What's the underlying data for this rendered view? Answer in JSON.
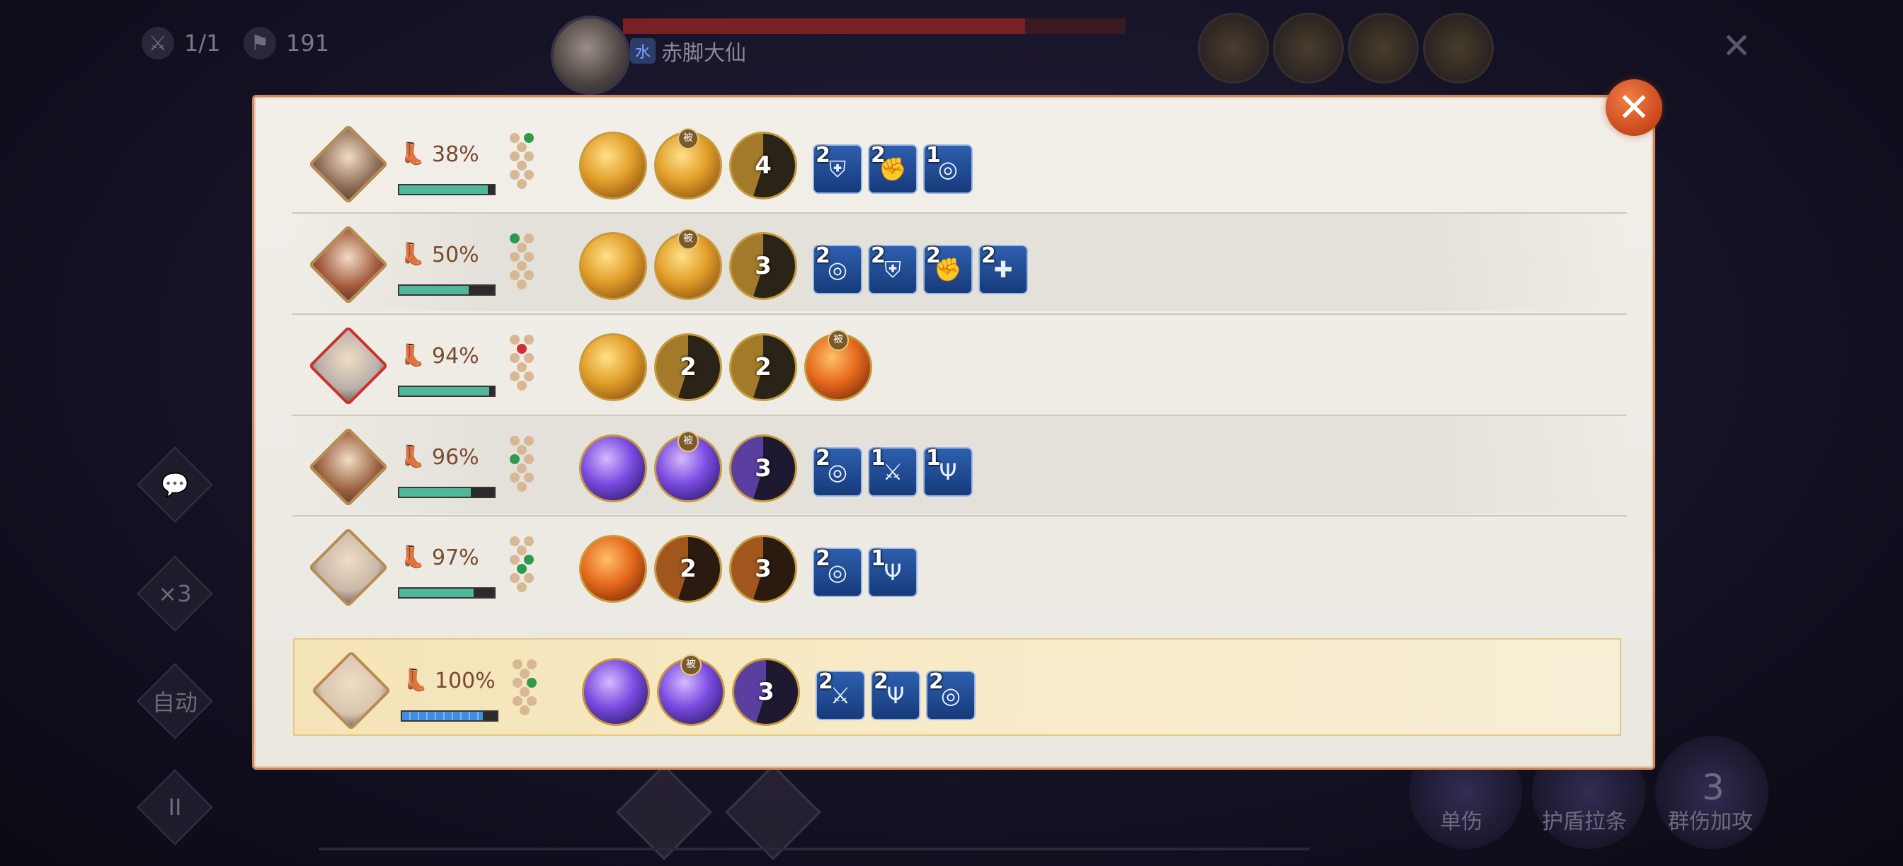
{
  "topbar": {
    "kills": "1/1",
    "flags": "191",
    "boss_name": "赤脚大仙",
    "boss_element": "水",
    "boss_hp_fraction": 0.8
  },
  "side": {
    "chat_icon": "chat-bubble-icon",
    "speed": "×3",
    "auto": "自动",
    "pause": "II"
  },
  "bottom": {
    "skill_single": "单伤",
    "skill_shield": "护盾拉条",
    "skill_group": "群伤加攻",
    "skill_group_count": "3"
  },
  "colors": {
    "accent": "#d04f20",
    "hp_green": "#50b89a",
    "highlight": "#f8ebc8"
  },
  "rows": [
    {
      "speed": "38%",
      "hp": 0.93,
      "pips": [
        "green"
      ],
      "pip_pos": [
        1
      ],
      "skills": [
        {
          "type": "gold"
        },
        {
          "type": "gold",
          "badge": "被"
        },
        {
          "type": "dark",
          "label": "4"
        }
      ],
      "buffs": [
        {
          "count": "2",
          "icon": "shield"
        },
        {
          "count": "2",
          "icon": "strength"
        },
        {
          "count": "1",
          "icon": "guard"
        }
      ]
    },
    {
      "speed": "50%",
      "hp": 0.73,
      "pips": [
        "green"
      ],
      "pip_pos": [
        0
      ],
      "skills": [
        {
          "type": "gold"
        },
        {
          "type": "gold",
          "badge": "被"
        },
        {
          "type": "dark",
          "label": "3"
        }
      ],
      "buffs": [
        {
          "count": "2",
          "icon": "guard"
        },
        {
          "count": "2",
          "icon": "shield"
        },
        {
          "count": "2",
          "icon": "strength"
        },
        {
          "count": "2",
          "icon": "heal"
        }
      ]
    },
    {
      "speed": "94%",
      "hp": 0.95,
      "pips": [
        "red"
      ],
      "pip_pos": [
        2
      ],
      "skills": [
        {
          "type": "gold"
        },
        {
          "type": "dark",
          "label": "2"
        },
        {
          "type": "dark",
          "label": "2"
        },
        {
          "type": "orange",
          "badge": "被"
        }
      ],
      "buffs": []
    },
    {
      "speed": "96%",
      "hp": 0.75,
      "pips": [
        "green"
      ],
      "pip_pos": [
        3
      ],
      "skills": [
        {
          "type": "purple"
        },
        {
          "type": "purple",
          "badge": "被"
        },
        {
          "type": "darkp",
          "label": "3"
        }
      ],
      "buffs": [
        {
          "count": "2",
          "icon": "guard"
        },
        {
          "count": "1",
          "icon": "sword"
        },
        {
          "count": "1",
          "icon": "trident"
        }
      ]
    },
    {
      "speed": "97%",
      "hp": 0.78,
      "pips": [
        "green",
        "green"
      ],
      "pip_pos": [
        4,
        5
      ],
      "skills": [
        {
          "type": "orange"
        },
        {
          "type": "darko",
          "label": "2"
        },
        {
          "type": "darko",
          "label": "3"
        }
      ],
      "buffs": [
        {
          "count": "2",
          "icon": "guard"
        },
        {
          "count": "1",
          "icon": "trident"
        }
      ]
    },
    {
      "speed": "100%",
      "hp": 0.85,
      "segmented": true,
      "pips": [
        "green"
      ],
      "pip_pos": [
        4
      ],
      "skills": [
        {
          "type": "purple"
        },
        {
          "type": "purple",
          "badge": "被"
        },
        {
          "type": "darkp",
          "label": "3"
        }
      ],
      "buffs": [
        {
          "count": "2",
          "icon": "sword"
        },
        {
          "count": "2",
          "icon": "trident"
        },
        {
          "count": "2",
          "icon": "guard"
        }
      ]
    }
  ]
}
